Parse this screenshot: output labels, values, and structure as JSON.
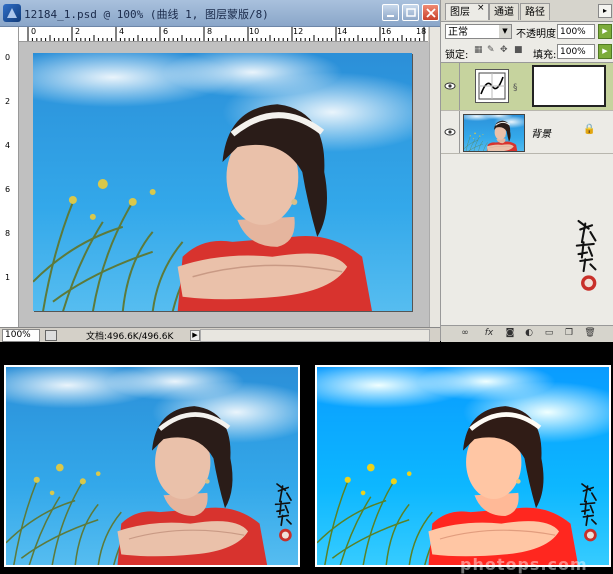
{
  "window": {
    "title": "12184_1.psd @ 100% (曲线 1, 图层蒙版/8)",
    "ruler_top_ticks": [
      "0",
      "2",
      "4",
      "6",
      "8",
      "10",
      "12",
      "14",
      "16",
      "18"
    ],
    "ruler_left_ticks": [
      "0",
      "2",
      "4",
      "6",
      "8",
      "1"
    ]
  },
  "status": {
    "zoom": "100%",
    "doc_size": "文档:496.6K/496.6K"
  },
  "layers_panel": {
    "tabs": [
      "图层",
      "通道",
      "路径"
    ],
    "tab_close": "×",
    "blend_mode": "正常",
    "opacity_label": "不透明度:",
    "opacity_value": "100%",
    "lock_label": "锁定:",
    "fill_label": "填充:",
    "fill_value": "100%",
    "layers": [
      {
        "name": "",
        "kind": "curves-adjustment",
        "has_mask": true
      },
      {
        "name": "背景",
        "kind": "image",
        "locked": true
      }
    ],
    "bottom_buttons": [
      "link-icon",
      "fx",
      "mask-icon",
      "adjustment-icon",
      "folder-icon",
      "new-layer-icon",
      "trash-icon"
    ]
  },
  "colors": {
    "sky": "#2a9ee6",
    "sky_light": "#7fc6ee",
    "shirt": "#d8332e",
    "active_layer": "#c6d39e",
    "titlebar": "#8aa6c9",
    "stamp": "#c8302a"
  },
  "comparison": {
    "left": "before",
    "right": "after",
    "watermark": "photops.com"
  }
}
